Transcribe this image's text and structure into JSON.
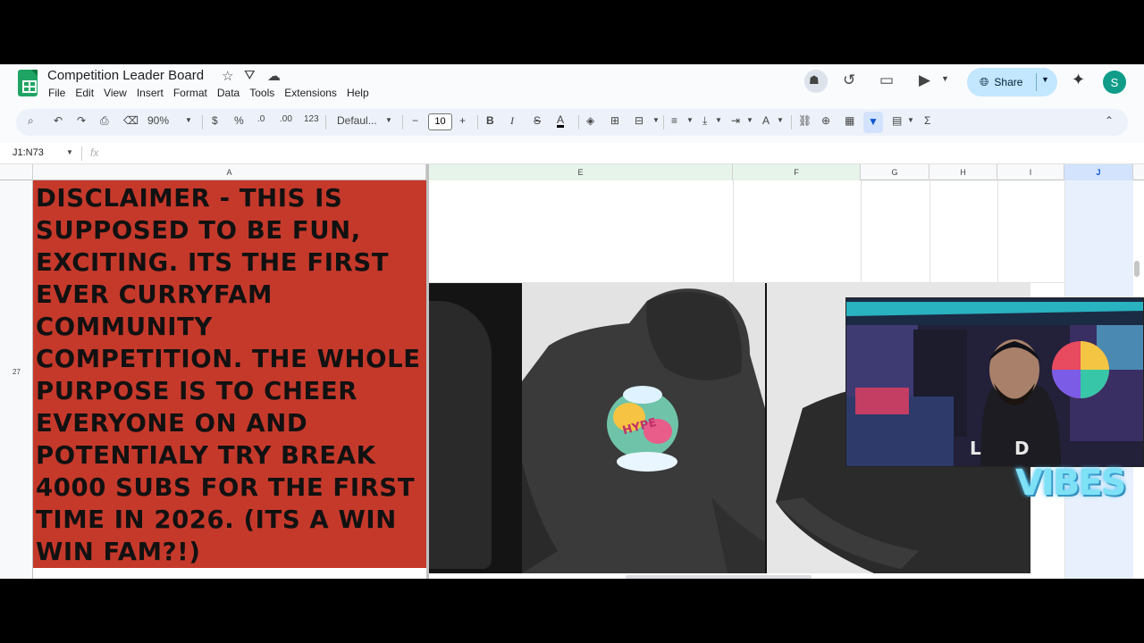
{
  "app": {
    "title": "Competition Leader Board",
    "share_label": "Share",
    "avatar_initial": "S"
  },
  "menu": [
    "File",
    "Edit",
    "View",
    "Insert",
    "Format",
    "Data",
    "Tools",
    "Extensions",
    "Help"
  ],
  "toolbar": {
    "zoom": "90%",
    "currency": "$",
    "percent": "%",
    "dec_decrease": ".0",
    "dec_increase": ".00",
    "number_format": "123",
    "font": "Defaul...",
    "font_size": "10",
    "bold": "B",
    "italic": "I",
    "strike": "S",
    "text_color": "A"
  },
  "formula_bar": {
    "name_box": "J1:N73",
    "fx": "fx"
  },
  "columns": [
    "A",
    "E",
    "F",
    "G",
    "H",
    "I",
    "J"
  ],
  "rows": {
    "main_row": "27"
  },
  "cell_a27": "DISCLAIMER - THIS IS SUPPOSED TO BE FUN, EXCITING. ITS THE FIRST EVER CURRYFAM COMMUNITY COMPETITION. THE WHOLE PURPOSE IS TO CHEER EVERYONE ON AND POTENTIALY TRY BREAK 4000 SUBS FOR THE FIRST TIME IN 2026. (ITS A WIN WIN FAM?!)",
  "overlay_text": "VIBES",
  "colors": {
    "accent_cell": "#c5392b",
    "share_bg": "#c2e7ff",
    "sheets_green": "#1fa463"
  }
}
